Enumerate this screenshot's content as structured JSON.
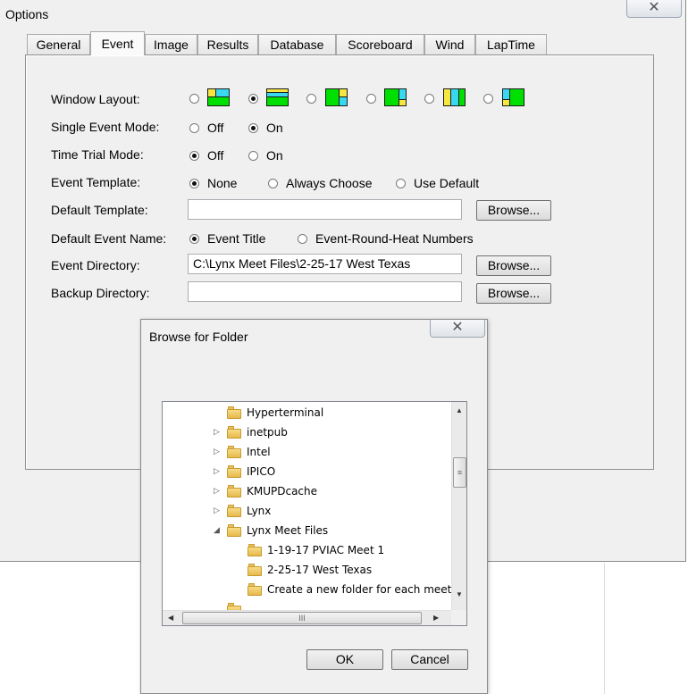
{
  "options": {
    "title": "Options",
    "close_glyph": "✕",
    "tabs": [
      "General",
      "Event",
      "Image",
      "Results",
      "Database",
      "Scoreboard",
      "Wind",
      "LapTime"
    ],
    "active_tab": "Event",
    "window_layout": {
      "label": "Window Layout:",
      "selected_index": 1,
      "option_count": 6
    },
    "single_event_mode": {
      "label": "Single Event Mode:",
      "options": [
        "Off",
        "On"
      ],
      "selected": "On"
    },
    "time_trial_mode": {
      "label": "Time Trial Mode:",
      "options": [
        "Off",
        "On"
      ],
      "selected": "Off"
    },
    "event_template": {
      "label": "Event Template:",
      "options": [
        "None",
        "Always Choose",
        "Use Default"
      ],
      "selected": "None"
    },
    "default_template": {
      "label": "Default Template:",
      "value": "",
      "browse": "Browse..."
    },
    "default_event_name": {
      "label": "Default Event Name:",
      "options": [
        "Event Title",
        "Event-Round-Heat Numbers"
      ],
      "selected": "Event Title"
    },
    "event_directory": {
      "label": "Event Directory:",
      "value": "C:\\Lynx Meet Files\\2-25-17 West Texas",
      "browse": "Browse..."
    },
    "backup_directory": {
      "label": "Backup Directory:",
      "value": "",
      "browse": "Browse..."
    }
  },
  "browse_dialog": {
    "title": "Browse for Folder",
    "close_glyph": "✕",
    "tree": [
      {
        "label": "Hyperterminal",
        "level": 0,
        "expander": ""
      },
      {
        "label": "inetpub",
        "level": 0,
        "expander": "▷"
      },
      {
        "label": "Intel",
        "level": 0,
        "expander": "▷"
      },
      {
        "label": "IPICO",
        "level": 0,
        "expander": "▷"
      },
      {
        "label": "KMUPDcache",
        "level": 0,
        "expander": "▷"
      },
      {
        "label": "Lynx",
        "level": 0,
        "expander": "▷"
      },
      {
        "label": "Lynx Meet Files",
        "level": 0,
        "expander": "◢"
      },
      {
        "label": "1-19-17 PVIAC Meet 1",
        "level": 1,
        "expander": ""
      },
      {
        "label": "2-25-17 West Texas",
        "level": 1,
        "expander": ""
      },
      {
        "label": "Create a new folder for each meet",
        "level": 1,
        "expander": ""
      }
    ],
    "ok_label": "OK",
    "cancel_label": "Cancel",
    "scroll_grip": "≡",
    "hscroll_grip": "III"
  }
}
